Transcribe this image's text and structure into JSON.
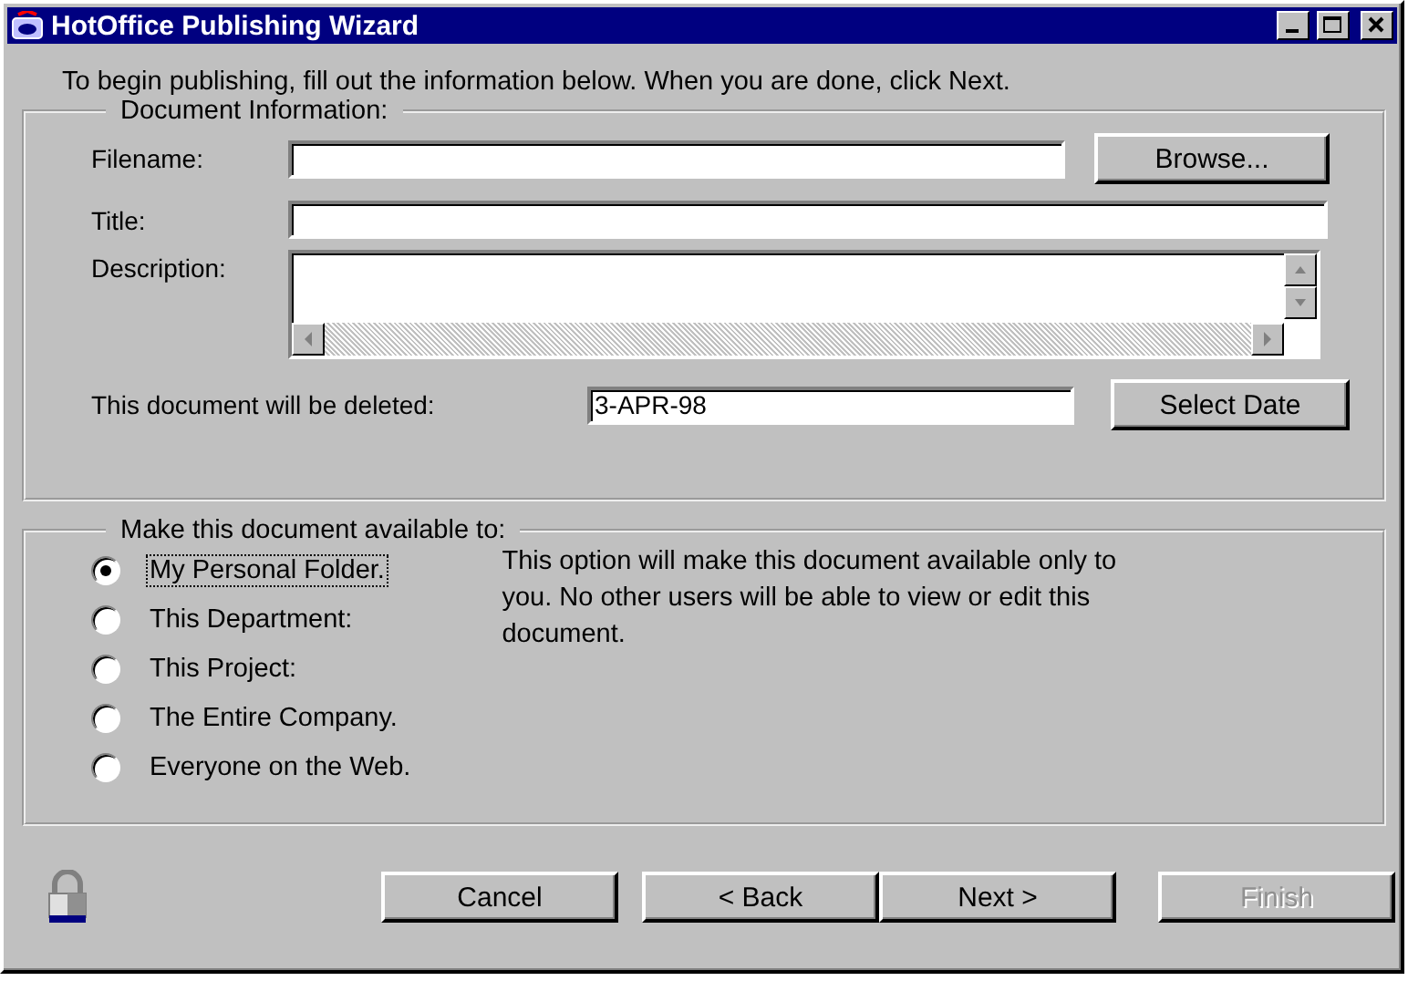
{
  "window": {
    "title": "HotOffice Publishing Wizard"
  },
  "intro": "To begin publishing, fill out the information below. When you are done, click Next.",
  "document_information": {
    "legend": "Document Information:",
    "filename": {
      "label": "Filename:",
      "button": "Browse..."
    },
    "title": {
      "label": "Title:"
    },
    "description": {
      "label": "Description:"
    },
    "deletion": {
      "label": "This document will be deleted:",
      "value": "3-APR-98",
      "button": "Select Date"
    }
  },
  "availability": {
    "legend": "Make this document available to:",
    "options": [
      {
        "label": "My Personal Folder.",
        "selected": true
      },
      {
        "label": "This Department:",
        "selected": false
      },
      {
        "label": "This Project:",
        "selected": false
      },
      {
        "label": "The Entire Company.",
        "selected": false
      },
      {
        "label": "Everyone on the Web.",
        "selected": false
      }
    ],
    "explanation": "This option will make this document available only to you. No other users will be able to view or edit this document."
  },
  "buttons": [
    {
      "label": "Cancel",
      "disabled": false
    },
    {
      "label": "< Back",
      "disabled": false
    },
    {
      "label": "Next >",
      "disabled": false
    },
    {
      "label": "Finish",
      "disabled": true
    }
  ]
}
